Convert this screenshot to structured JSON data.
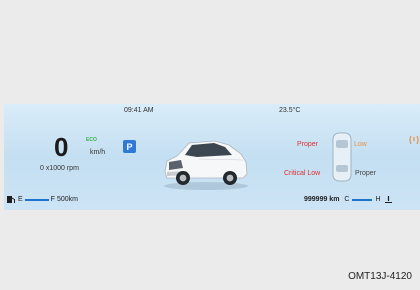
{
  "cluster": {
    "time": "09:41 AM",
    "outside_temp": "23.5°C",
    "speed": "0",
    "speed_unit": "km/h",
    "eco_label": "ECO",
    "rpm_text": "0 x1000 rpm",
    "gear": "P",
    "fuel_empty_label": "E",
    "fuel_full_label": "F",
    "range": "500km",
    "odometer": "999999 km",
    "coolant_cold_label": "C",
    "coolant_hot_label": "H",
    "tire_pressure": {
      "front_left": "Proper",
      "front_right": "Low",
      "rear_left": "Critical Low",
      "rear_right": "Proper"
    },
    "colors": {
      "eco": "#38b24a",
      "gear_badge": "#2f7ad6",
      "gauge_bar": "#1e72d0",
      "tire_low": "#e6904a",
      "tire_critical": "#e0302f"
    }
  },
  "figure_id": "OMT13J-4120"
}
